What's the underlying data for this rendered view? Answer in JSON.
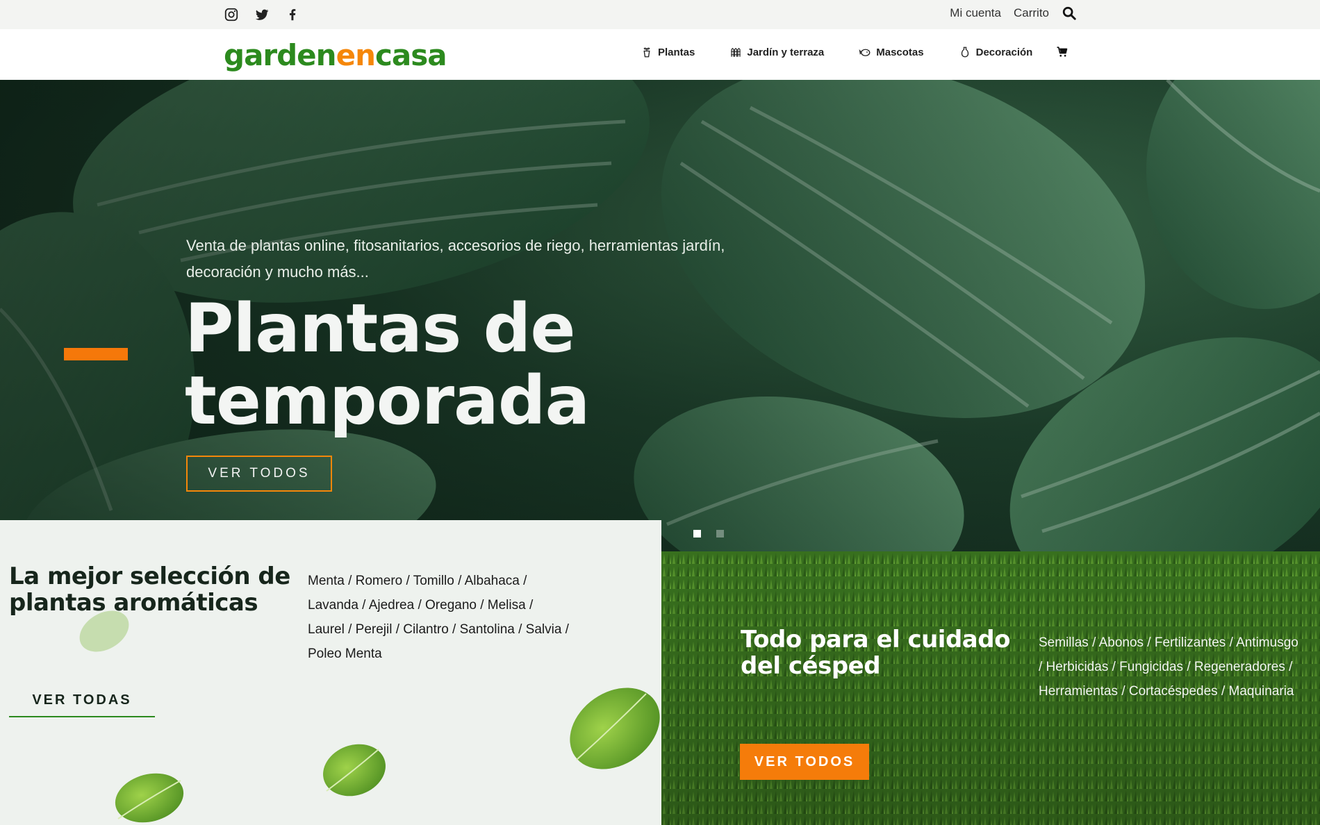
{
  "topbar": {
    "social": [
      {
        "icon": "instagram-icon"
      },
      {
        "icon": "twitter-icon"
      },
      {
        "icon": "facebook-icon"
      }
    ],
    "account_label": "Mi cuenta",
    "cart_label": "Carrito",
    "search_icon": "search-icon"
  },
  "navbar": {
    "logo": {
      "part1": "garden",
      "part2": "en",
      "part3": "casa"
    },
    "menu": [
      {
        "label": "Plantas",
        "icon": "plant-pot-icon"
      },
      {
        "label": "Jardín y terraza",
        "icon": "fence-icon"
      },
      {
        "label": "Mascotas",
        "icon": "pet-icon"
      },
      {
        "label": "Decoración",
        "icon": "vase-icon"
      }
    ],
    "cart_icon": "cart-icon"
  },
  "hero": {
    "subtitle": "Venta de plantas online, fitosanitarios, accesorios de riego, herramientas jardín, decoración y mucho más...",
    "title": "Plantas de temporada",
    "button": "VER TODOS",
    "slides": 2,
    "active_slide": 1
  },
  "aromatic": {
    "title": "La mejor selección de plantas aromáticas",
    "list": "Menta / Romero / Tomillo / Albahaca / Lavanda / Ajedrea / Oregano / Melisa / Laurel / Perejil / Cilantro / Santolina / Salvia / Poleo Menta",
    "button": "VER TODAS"
  },
  "lawn": {
    "title": "Todo para el cuidado del césped",
    "list": "Semillas / Abonos / Fertilizantes / Antimusgo / Herbicidas / Fungicidas / Regeneradores / Herramientas / Cortacéspedes / Maquinaria",
    "button": "VER TODOS"
  },
  "colors": {
    "brand_green": "#2c8a1e",
    "brand_orange": "#f5870a",
    "topbar_bg": "#f3f4f2",
    "hero_dark": "#1e3f2c"
  }
}
